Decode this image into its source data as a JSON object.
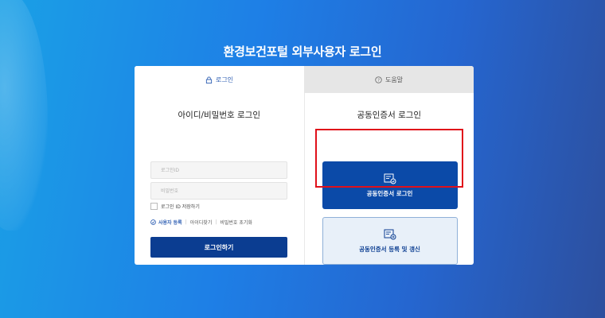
{
  "page": {
    "title": "환경보건포털 외부사용자 로그인"
  },
  "tabs": [
    {
      "label": "로그인",
      "icon": "lock-icon",
      "active": true
    },
    {
      "label": "도움말",
      "icon": "question-icon",
      "active": false
    }
  ],
  "id_login": {
    "heading": "아이디/비밀번호 로그인",
    "id_placeholder": "로그인ID",
    "pw_placeholder": "비밀번호",
    "remember_label": "로그인 ID 저장하기",
    "links": {
      "register": "사용자 등록",
      "find_id": "아이디찾기",
      "reset_pw": "비밀번호 초기화"
    },
    "submit_label": "로그인하기"
  },
  "cert_login": {
    "heading": "공동인증서 로그인",
    "login_label": "공동인증서 로그인",
    "register_label": "공동인증서 등록 및 갱신"
  },
  "colors": {
    "primary": "#0b3d91",
    "accent": "#2f5fb3",
    "highlight": "#e0101a"
  }
}
